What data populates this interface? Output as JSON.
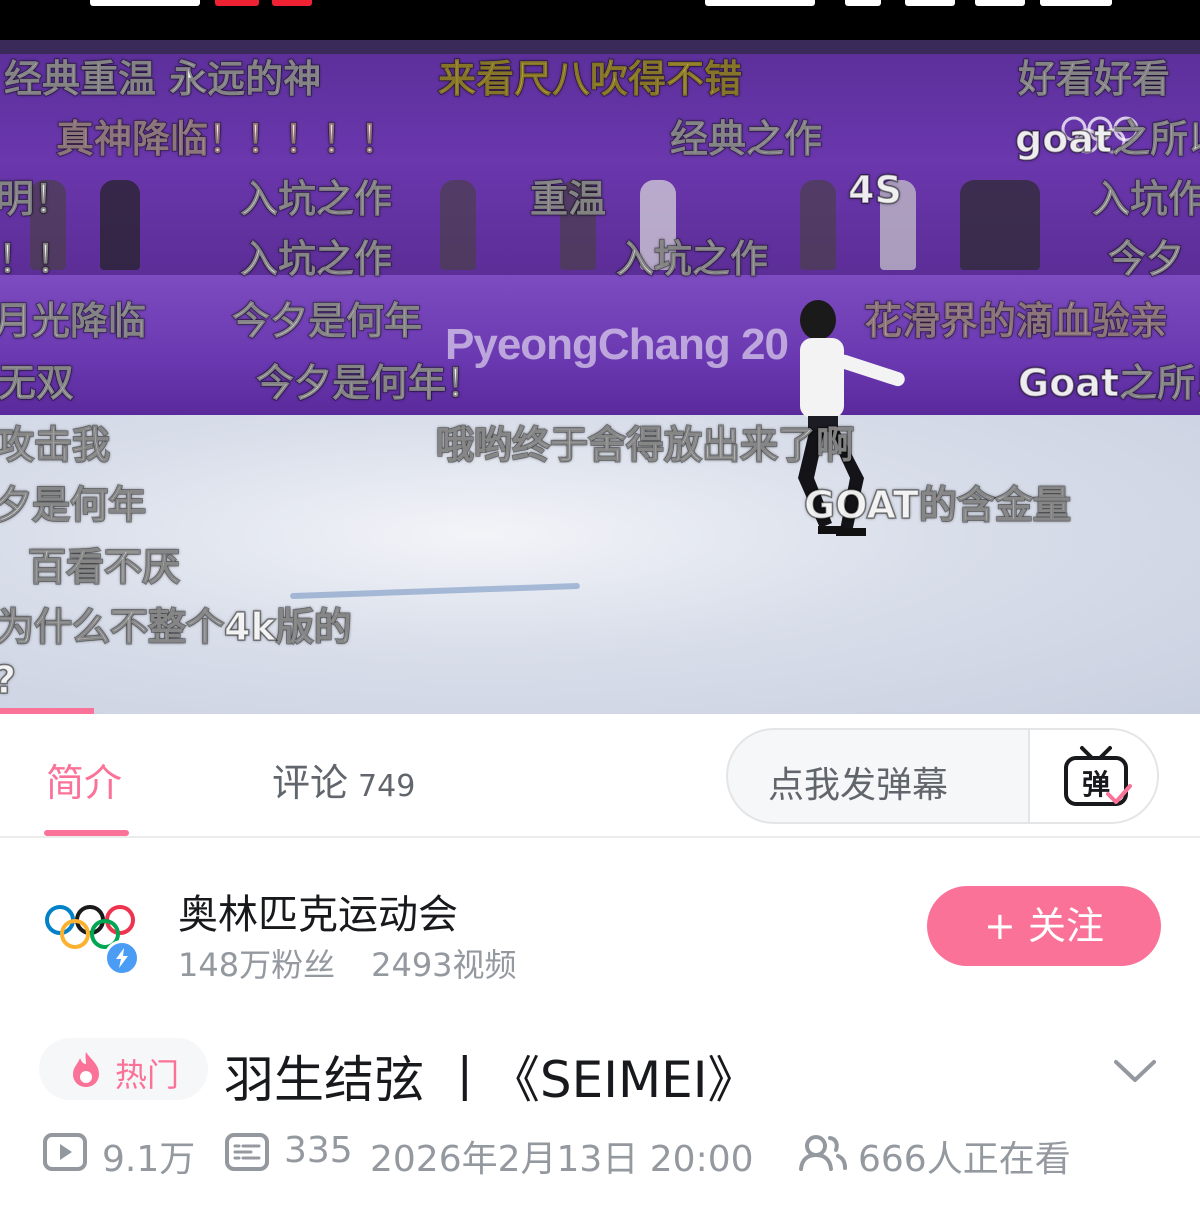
{
  "video": {
    "board_text": "PyeongChang 20",
    "danmaku": [
      {
        "text": "经典重温 永远的神"
      },
      {
        "text": "来看尺八吹得不错"
      },
      {
        "text": "好看好看"
      },
      {
        "text": "真神降临！！！！！"
      },
      {
        "text": "经典之作"
      },
      {
        "text": "goat之所以"
      },
      {
        "text": "明！"
      },
      {
        "text": "入坑之作"
      },
      {
        "text": "重温"
      },
      {
        "text": "4S"
      },
      {
        "text": "入坑作"
      },
      {
        "text": "！！"
      },
      {
        "text": "入坑之作"
      },
      {
        "text": "入坑之作"
      },
      {
        "text": "今夕"
      },
      {
        "text": "月光降临"
      },
      {
        "text": "今夕是何年"
      },
      {
        "text": "花滑界的滴血验亲"
      },
      {
        "text": "无双"
      },
      {
        "text": "今夕是何年！"
      },
      {
        "text": "Goat之所以"
      },
      {
        "text": "攻击我"
      },
      {
        "text": "哦哟终于舍得放出来了啊"
      },
      {
        "text": "GOAT的含金量"
      },
      {
        "text": "夕是何年"
      },
      {
        "text": "百看不厌"
      },
      {
        "text": "为什么不整个4k版的"
      },
      {
        "text": "?"
      }
    ],
    "progress_fraction": 0.078
  },
  "tabs": {
    "intro_label": "简介",
    "comments_label": "评论",
    "comments_count": "749",
    "danmaku_placeholder": "点我发弹幕",
    "danmaku_icon_text": "弹"
  },
  "uploader": {
    "name": "奥林匹克运动会",
    "fans": "148万粉丝",
    "videos": "2493视频",
    "follow_label": "+ 关注"
  },
  "title": {
    "hot_label": "热门",
    "text": "羽生结弦 丨《SEIMEI》"
  },
  "meta": {
    "views": "9.1万",
    "danmaku_count": "335",
    "date": "2026年2月13日 20:00",
    "watching": "666人正在看"
  },
  "colors": {
    "accent_pink": "#fb7299",
    "text_primary": "#18191c",
    "text_secondary": "#9499a0",
    "verify_blue": "#4a9cf5"
  }
}
